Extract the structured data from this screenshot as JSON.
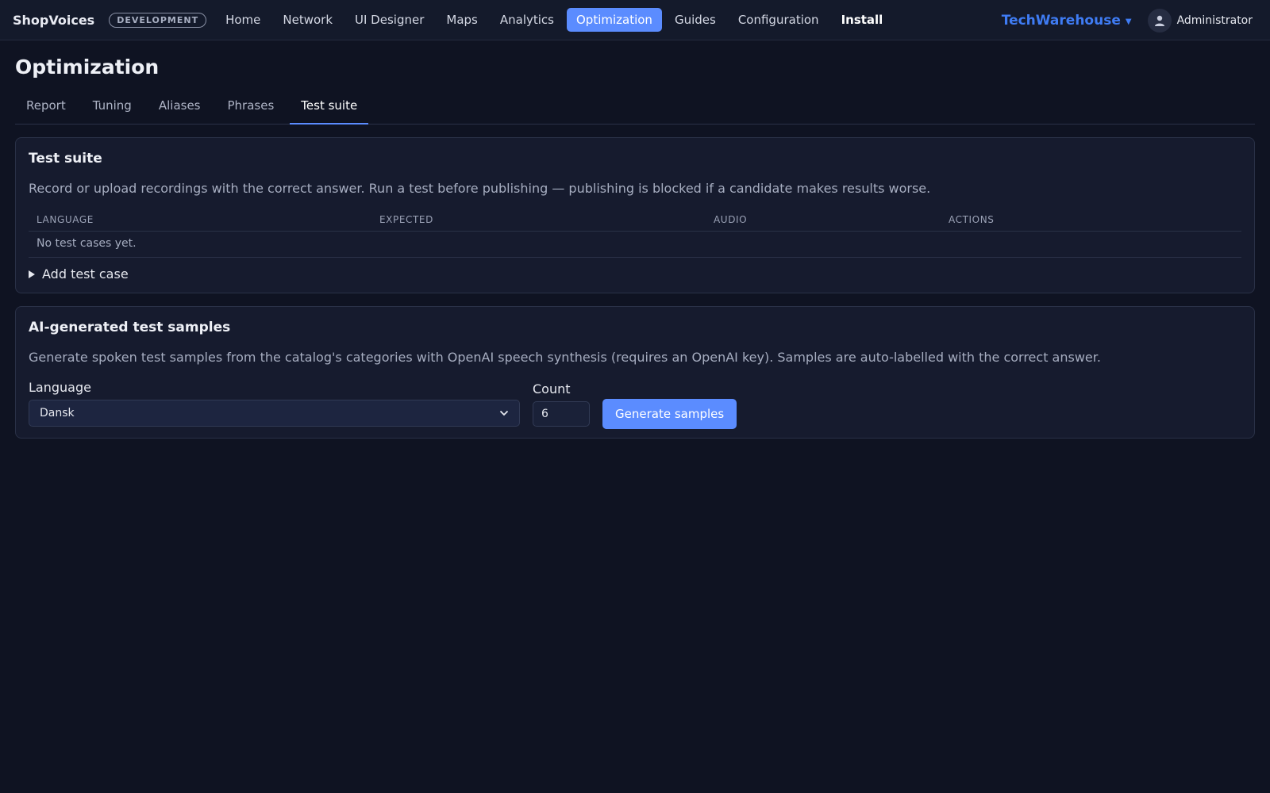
{
  "app": {
    "brand": "ShopVoices",
    "env_badge": "DEVELOPMENT"
  },
  "nav": {
    "items": [
      {
        "label": "Home"
      },
      {
        "label": "Network"
      },
      {
        "label": "UI Designer"
      },
      {
        "label": "Maps"
      },
      {
        "label": "Analytics"
      },
      {
        "label": "Optimization"
      },
      {
        "label": "Guides"
      },
      {
        "label": "Configuration"
      },
      {
        "label": "Install"
      }
    ],
    "active": "Optimization"
  },
  "header_right": {
    "workspace": "TechWarehouse",
    "user": "Administrator",
    "icons": [
      "caret-down-icon",
      "user-avatar-icon"
    ]
  },
  "page": {
    "title": "Optimization",
    "tabs": [
      {
        "label": "Report"
      },
      {
        "label": "Tuning"
      },
      {
        "label": "Aliases"
      },
      {
        "label": "Phrases"
      },
      {
        "label": "Test suite"
      }
    ],
    "active_tab": "Test suite"
  },
  "test_suite": {
    "title": "Test suite",
    "description": "Record or upload recordings with the correct answer. Run a test before publishing — publishing is blocked if a candidate makes results worse.",
    "columns": [
      "LANGUAGE",
      "EXPECTED",
      "AUDIO",
      "ACTIONS"
    ],
    "empty_text": "No test cases yet.",
    "add_label": "Add test case"
  },
  "ai_samples": {
    "title": "AI-generated test samples",
    "description": "Generate spoken test samples from the catalog's categories with OpenAI speech synthesis (requires an OpenAI key). Samples are auto-labelled with the correct answer.",
    "language_label": "Language",
    "language_value": "Dansk",
    "count_label": "Count",
    "count_value": "6",
    "generate_label": "Generate samples"
  },
  "colors": {
    "accent": "#5b8cff",
    "workspace": "#3f7cf4",
    "background": "#0f1322"
  }
}
